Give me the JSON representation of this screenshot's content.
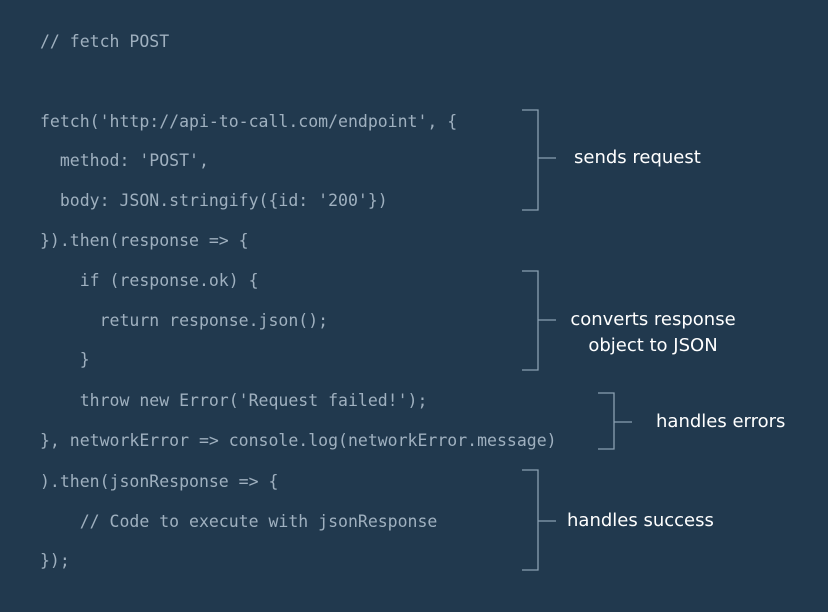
{
  "code_lines": [
    "// fetch POST",
    "fetch('http://api-to-call.com/endpoint', {",
    "  method: 'POST',",
    "  body: JSON.stringify({id: '200'})",
    "}).then(response => {",
    "    if (response.ok) {",
    "      return response.json();",
    "    }",
    "    throw new Error('Request failed!');",
    "}, networkError => console.log(networkError.message)",
    ").then(jsonResponse => {",
    "    // Code to execute with jsonResponse",
    "});"
  ],
  "annotations": {
    "sends_request": "sends request",
    "converts_line1": "converts response",
    "converts_line2": "object to JSON",
    "handles_errors": "handles errors",
    "handles_success": "handles success"
  },
  "colors": {
    "background": "#21394e",
    "code_text": "#9fb0bf",
    "annotation_text": "#ffffff",
    "bracket": "#8aa0b2"
  }
}
